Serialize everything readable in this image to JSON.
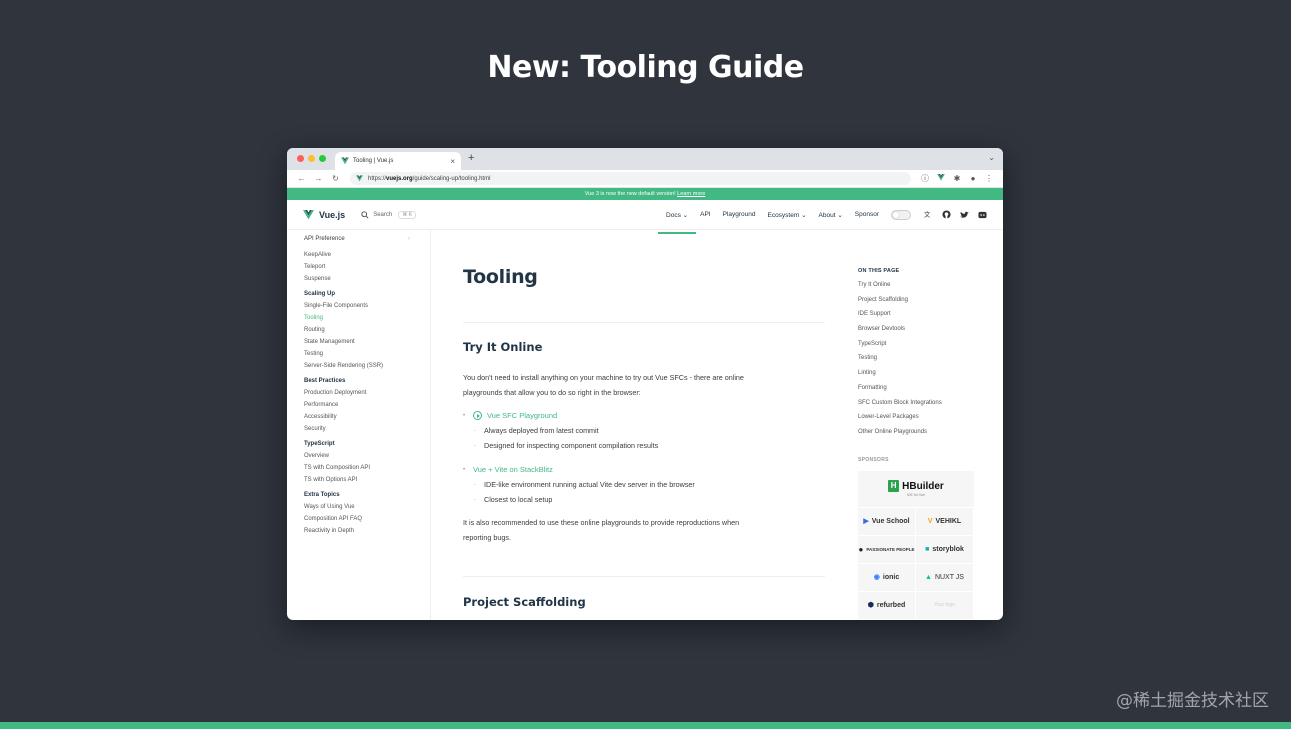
{
  "slide": {
    "title": "New: Tooling Guide"
  },
  "browser": {
    "tab_title": "Tooling | Vue.js",
    "tab_close": "×",
    "new_tab": "+",
    "url_prefix": "https://",
    "url_domain": "vuejs.org",
    "url_path": "/guide/scaling-up/tooling.html"
  },
  "banner": {
    "text": "Vue 3 is now the new default version!",
    "link": "Learn more"
  },
  "nav": {
    "brand": "Vue.js",
    "search_label": "Search",
    "search_kbd": "⌘ K",
    "items": [
      {
        "label": "Docs ⌄"
      },
      {
        "label": "API"
      },
      {
        "label": "Playground"
      },
      {
        "label": "Ecosystem ⌄"
      },
      {
        "label": "About ⌄"
      },
      {
        "label": "Sponsor"
      }
    ]
  },
  "sidebar": {
    "top": "API Preference",
    "groups": [
      {
        "head": "",
        "items": [
          "KeepAlive",
          "Teleport",
          "Suspense"
        ]
      },
      {
        "head": "Scaling Up",
        "items": [
          "Single-File Components",
          "Tooling",
          "Routing",
          "State Management",
          "Testing",
          "Server-Side Rendering (SSR)"
        ]
      },
      {
        "head": "Best Practices",
        "items": [
          "Production Deployment",
          "Performance",
          "Accessibility",
          "Security"
        ]
      },
      {
        "head": "TypeScript",
        "items": [
          "Overview",
          "TS with Composition API",
          "TS with Options API"
        ]
      },
      {
        "head": "Extra Topics",
        "items": [
          "Ways of Using Vue",
          "Composition API FAQ",
          "Reactivity in Depth"
        ]
      }
    ]
  },
  "main": {
    "title": "Tooling",
    "section1": "Try It Online",
    "intro_1": "You don't need to install anything on your machine to try out Vue SFCs - there are online",
    "intro_2": "playgrounds that allow you to do so right in the browser:",
    "item1": "Vue SFC Playground",
    "item1_sub1": "Always deployed from latest commit",
    "item1_sub2": "Designed for inspecting component compilation results",
    "item2": "Vue + Vite on StackBlitz",
    "item2_sub1": "IDE-like environment running actual Vite dev server in the browser",
    "item2_sub2": "Closest to local setup",
    "outro_1": "It is also recommended to use these online playgrounds to provide reproductions when",
    "outro_2": "reporting bugs.",
    "section2": "Project Scaffolding"
  },
  "aside": {
    "head": "ON THIS PAGE",
    "items": [
      "Try It Online",
      "Project Scaffolding",
      "IDE Support",
      "Browser Devtools",
      "TypeScript",
      "Testing",
      "Linting",
      "Formatting",
      "SFC Custom Block Integrations",
      "Lower-Level Packages",
      "Other Online Playgrounds"
    ],
    "sponsors_head": "SPONSORS",
    "sponsor_main": "HBuilder",
    "sponsor_main_mark": "H",
    "sponsor_main_sub": "IDE for Vue",
    "sponsors": [
      "Vue School",
      "VEHIKL",
      "PASSIONATE PEOPLE",
      "storyblok",
      "ionic",
      "NUXT JS",
      "refurbed",
      "Your logo"
    ]
  },
  "watermark": "@稀土掘金技术社区",
  "colors": {
    "accent": "#42b883",
    "background": "#2f343d",
    "text": "#213547"
  }
}
